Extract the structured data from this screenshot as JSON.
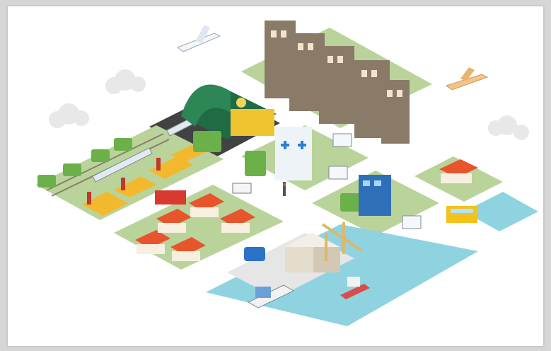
{
  "image": {
    "background": "#d6d6d6",
    "canvas_color": "#ffffff",
    "palette": {
      "grass": "#b9d39a",
      "road": "#ffffff",
      "water": "#8fd3e0",
      "roof_red": "#e8542b",
      "factory_yellow": "#f2b92e",
      "station_green": "#1f6b44",
      "tower_brown": "#8a7a68",
      "hospital_white": "#eef3f8",
      "cross_blue": "#2a7fd1"
    },
    "scene_elements": [
      "airplane-icon",
      "propeller-plane-icon",
      "train-station-icon",
      "clock-icon",
      "factory-icon",
      "train-icon",
      "apartment-tower-icon",
      "hospital-icon",
      "house-icon",
      "ambulance-icon",
      "truck-icon",
      "bus-icon",
      "car-icon",
      "ship-icon",
      "tugboat-icon",
      "harbor-crane-icon",
      "warehouse-icon",
      "traffic-light-icon",
      "tree-icon",
      "cloud-icon"
    ]
  }
}
